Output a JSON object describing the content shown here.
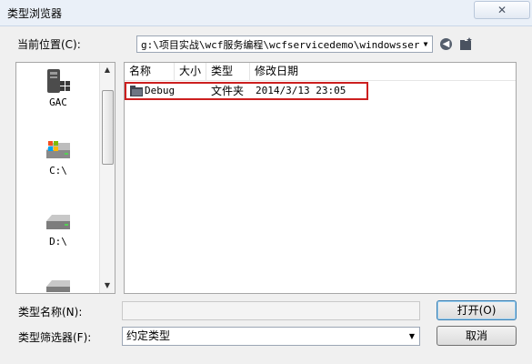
{
  "window": {
    "title": "类型浏览器",
    "close_glyph": "✕"
  },
  "lookin": {
    "label": "当前位置(C):",
    "path": "g:\\项目实战\\wcf服务编程\\wcfservicedemo\\windowsservi",
    "dropdown_glyph": "▼"
  },
  "toolbar": {
    "back_glyph": "◀",
    "back_icon": "back-arrow-icon",
    "newfolder_icon": "new-folder-icon"
  },
  "places": [
    {
      "label": "GAC",
      "icon": "gac-icon"
    },
    {
      "label": "C:\\",
      "icon": "drive-c-icon"
    },
    {
      "label": "D:\\",
      "icon": "drive-d-icon"
    },
    {
      "label": "",
      "icon": "drive-icon"
    }
  ],
  "scrollbar": {
    "up": "▲",
    "down": "▼"
  },
  "filelist": {
    "columns": [
      "名称",
      "大小",
      "类型",
      "修改日期"
    ],
    "rows": [
      {
        "name": "Debug",
        "size": "",
        "type": "文件夹",
        "modified": "2014/3/13 23:05",
        "icon": "folder-icon"
      }
    ]
  },
  "form": {
    "type_name_label": "类型名称(N):",
    "type_name_value": "",
    "filter_label": "类型筛选器(F):",
    "filter_value": "约定类型",
    "filter_dropdown_glyph": "▼"
  },
  "buttons": {
    "open": "打开(O)",
    "cancel": "取消"
  },
  "colors": {
    "highlight_border": "#cc1f1f",
    "dialog_bg": "#f0f0f0"
  }
}
